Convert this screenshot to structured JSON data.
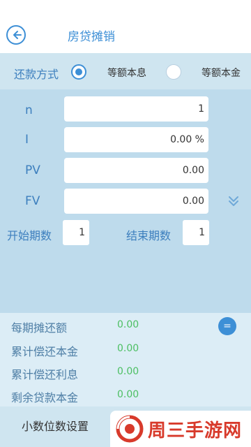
{
  "header": {
    "title": "房贷摊销"
  },
  "repayment": {
    "label": "还款方式",
    "options": [
      {
        "label": "等额本息",
        "selected": true
      },
      {
        "label": "等额本金",
        "selected": false
      }
    ]
  },
  "fields": [
    {
      "label": "n",
      "value": "1"
    },
    {
      "label": "I",
      "value": "0.00 %"
    },
    {
      "label": "PV",
      "value": "0.00"
    },
    {
      "label": "FV",
      "value": "0.00"
    }
  ],
  "period": {
    "start_label": "开始期数",
    "start_value": "1",
    "end_label": "结束期数",
    "end_value": "1"
  },
  "results": [
    {
      "label": "每期摊还额",
      "value": "0.00"
    },
    {
      "label": "累计偿还本金",
      "value": "0.00"
    },
    {
      "label": "累计偿还利息",
      "value": "0.00"
    },
    {
      "label": "剩余贷款本金",
      "value": "0.00"
    }
  ],
  "equals_button": "=",
  "footer": {
    "decimal_label": "小数位数设置",
    "watermark_text": "周三手游网"
  },
  "colors": {
    "accent": "#3d8fd6",
    "result_value": "#4cbf62",
    "watermark": "#d83a2b"
  }
}
